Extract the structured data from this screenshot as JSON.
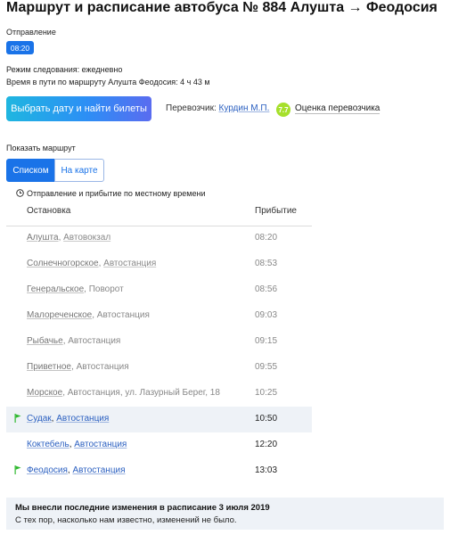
{
  "page": {
    "title": "Маршрут и расписание автобуса № 884 Алушта → Феодосия"
  },
  "departure": {
    "label": "Отправление",
    "time": "08:20"
  },
  "schedule_mode": "Режим следования: ежедневно",
  "travel_time": "Время в пути по маршруту Алушта Феодосия: 4 ч 43 м",
  "buy_button": "Выбрать дату и найти билеты",
  "carrier": {
    "label": "Перевозчик:",
    "name": "Курдин М.П.",
    "rating": "7.7",
    "rating_link": "Оценка перевозчика"
  },
  "route_view": {
    "label": "Показать маршрут",
    "tabs": [
      "Списком",
      "На карте"
    ]
  },
  "local_time_note": "Отправление и прибытие по местному времени",
  "table": {
    "headers": {
      "stop": "Остановка",
      "arrival": "Прибытие"
    },
    "rows": [
      {
        "city": "Алушта",
        "sep": ", ",
        "place": "Автовокзал",
        "time": "08:20"
      },
      {
        "city": "Солнечногорское",
        "sep": ", ",
        "place": "Автостанция",
        "time": "08:53"
      },
      {
        "city": "Генеральское",
        "sep": ", ",
        "place": "Поворот",
        "time": "08:56"
      },
      {
        "city": "Малореченское",
        "sep": ", ",
        "place": "Автостанция",
        "time": "09:03"
      },
      {
        "city": "Рыбачье",
        "sep": ", ",
        "place": "Автостанция",
        "time": "09:15"
      },
      {
        "city": "Приветное",
        "sep": ", ",
        "place": "Автостанция",
        "time": "09:55"
      },
      {
        "city": "Морское",
        "sep": ", ",
        "place": "Автостанция, ул. Лазурный Берег, 18",
        "time": "10:25"
      },
      {
        "city": "Судак",
        "sep": ", ",
        "place": "Автостанция",
        "time": "10:50"
      },
      {
        "city": "Коктебель",
        "sep": ", ",
        "place": "Автостанция",
        "time": "12:20"
      },
      {
        "city": "Феодосия",
        "sep": ", ",
        "place": "Автостанция",
        "time": "13:03"
      }
    ]
  },
  "notice": {
    "title": "Мы внесли последние изменения в расписание 3 июля 2019",
    "text": "С тех пор, насколько нам известно, изменений не было."
  },
  "colors": {
    "accent": "#1a73e8",
    "rating": "#a6e02c",
    "flag": "#2fb82f",
    "highlight_row": "#eef2f7"
  },
  "icons": {
    "flag": "flag-icon",
    "clock": "clock-icon"
  }
}
